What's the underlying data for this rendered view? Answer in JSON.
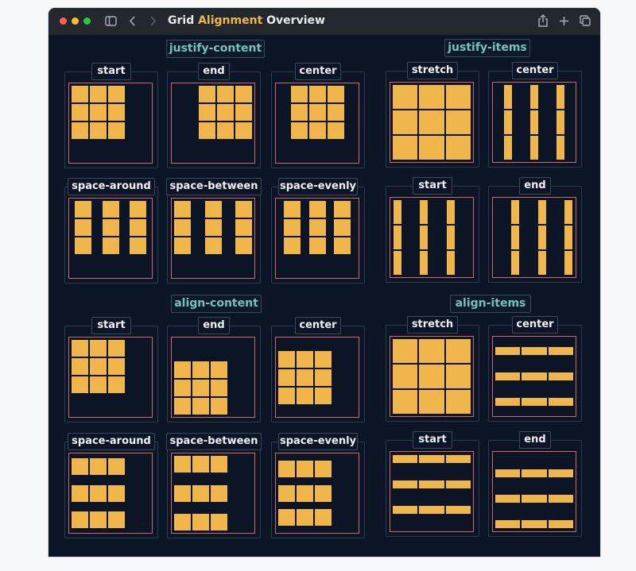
{
  "window": {
    "title_pre": "Grid ",
    "title_hl": "Alignment",
    "title_post": " Overview",
    "colors": {
      "close": "#ff5f57",
      "minimize": "#febc2e",
      "zoom": "#28c840",
      "cell": "#f1b64b",
      "container": "#d06a6a",
      "heading": "#73c2c0"
    },
    "icons": [
      "sidebar-icon",
      "chevron-left-icon",
      "chevron-right-icon",
      "share-icon",
      "plus-icon",
      "copy-icon"
    ]
  },
  "sections": [
    {
      "id": "jc",
      "title": "justify-content",
      "items": [
        {
          "label": "start",
          "mode": "jc-start"
        },
        {
          "label": "end",
          "mode": "jc-end"
        },
        {
          "label": "center",
          "mode": "jc-center"
        },
        {
          "label": "space-around",
          "mode": "jc-around"
        },
        {
          "label": "space-between",
          "mode": "jc-between"
        },
        {
          "label": "space-evenly",
          "mode": "jc-evenly"
        }
      ]
    },
    {
      "id": "ji",
      "title": "justify-items",
      "items": [
        {
          "label": "stretch",
          "mode": "ji-stretch"
        },
        {
          "label": "center",
          "mode": "ji-center"
        },
        {
          "label": "start",
          "mode": "ji-start"
        },
        {
          "label": "end",
          "mode": "ji-end"
        }
      ]
    },
    {
      "id": "ac",
      "title": "align-content",
      "items": [
        {
          "label": "start",
          "mode": "ac-start"
        },
        {
          "label": "end",
          "mode": "ac-end"
        },
        {
          "label": "center",
          "mode": "ac-center"
        },
        {
          "label": "space-around",
          "mode": "ac-around"
        },
        {
          "label": "space-between",
          "mode": "ac-between"
        },
        {
          "label": "space-evenly",
          "mode": "ac-evenly"
        }
      ]
    },
    {
      "id": "ai",
      "title": "align-items",
      "items": [
        {
          "label": "stretch",
          "mode": "ai-stretch"
        },
        {
          "label": "center",
          "mode": "ai-center"
        },
        {
          "label": "start",
          "mode": "ai-start"
        },
        {
          "label": "end",
          "mode": "ai-end"
        }
      ]
    }
  ]
}
